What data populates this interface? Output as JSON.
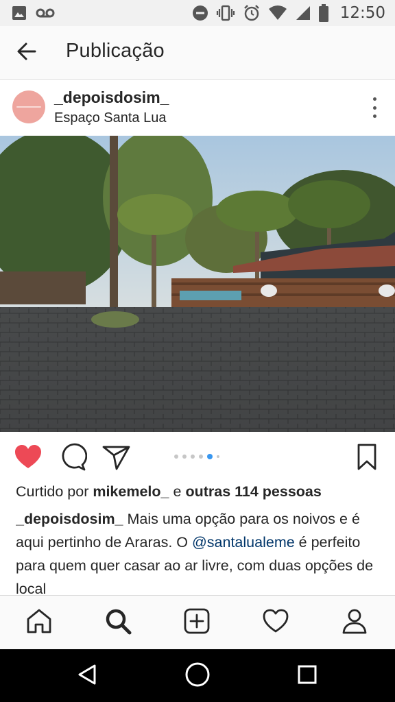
{
  "status_bar": {
    "time": "12:50",
    "icons": [
      "image-icon",
      "voicemail-icon",
      "do-not-disturb-icon",
      "vibrate-icon",
      "alarm-icon",
      "wifi-icon",
      "signal-icon",
      "battery-icon"
    ]
  },
  "app_bar": {
    "title": "Publicação",
    "back_icon": "arrow-left-icon"
  },
  "post": {
    "username": "_depoisdosim_",
    "location": "Espaço Santa Lua",
    "more_icon": "more-vertical-icon",
    "image_description_icon": "photo",
    "carousel": {
      "count": 6,
      "active_index": 4
    },
    "actions": {
      "like_icon": "heart-filled-icon",
      "comment_icon": "comment-icon",
      "share_icon": "send-icon",
      "save_icon": "bookmark-icon",
      "like_color": "#ed4956"
    },
    "likes": {
      "prefix": "Curtido por",
      "user": "mikemelo_",
      "connector": "e",
      "others": "outras 114 pessoas"
    },
    "caption": {
      "user": "_depoisdosim_",
      "text_1": " Mais uma opção para os noivos e é aqui pertinho de Araras. O ",
      "mention": "@santalualeme",
      "text_2": " é perfeito para quem quer casar ao ar livre, com duas opções de local"
    }
  },
  "bottom_nav": {
    "items": [
      "home-icon",
      "search-icon",
      "add-post-icon",
      "activity-heart-icon",
      "profile-icon"
    ],
    "active": "search-icon"
  },
  "system_nav": {
    "items": [
      "back-triangle-icon",
      "home-circle-icon",
      "recents-square-icon"
    ]
  },
  "colors": {
    "accent_blue": "#3897f0",
    "like_red": "#ed4956",
    "mention": "#003569",
    "avatar": "#eea59e"
  }
}
